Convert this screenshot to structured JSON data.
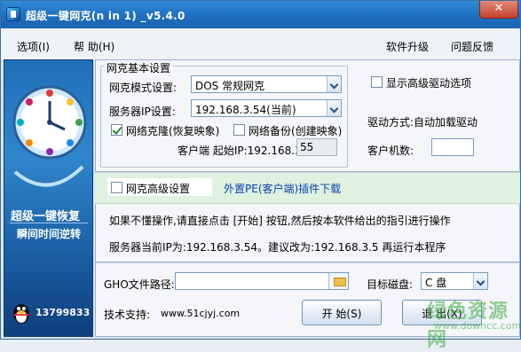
{
  "window": {
    "title": "超级一键网克(n in 1) _v5.4.0",
    "close_label": "✕"
  },
  "menubar": {
    "left": [
      {
        "label": "选项(I)"
      },
      {
        "label": "帮 助(H)"
      }
    ],
    "right": [
      {
        "label": "软件升级"
      },
      {
        "label": "问题反馈"
      }
    ]
  },
  "sidebar": {
    "slogan1": "超级一键恢复",
    "slogan2": "瞬间时间逆转",
    "qq_number": "13799833",
    "clock_icon": "clock-icon",
    "qq_icon": "qq-penguin-icon"
  },
  "basic": {
    "legend": "网克基本设置",
    "mode_label": "网克模式设置:",
    "mode_value": "DOS 常规网克",
    "server_label": "服务器IP设置:",
    "server_value": "192.168.3.54(当前)",
    "clone_restore_label": "网络克隆(恢复映象)",
    "clone_restore_checked": true,
    "backup_label": "网络备份(创建映象)",
    "backup_checked": false,
    "client_ip_label": "客户端 起始IP:192.168.3.",
    "client_ip_value": "55",
    "show_driver_label": "显示高级驱动选项",
    "show_driver_checked": false,
    "driver_mode_text": "驱动方式:自动加载驱动",
    "client_count_label": "客户机数:",
    "client_count_value": ""
  },
  "advanced": {
    "label": "网克高级设置",
    "checked": false,
    "plugin_link": "外置PE(客户端)插件下载"
  },
  "info": {
    "line1": "如果不懂操作,请直接点击 [开始] 按钮,然后按本软件给出的指引进行操作",
    "line2": "服务器当前IP为:192.168.3.54。建议改为:192.168.3.5 再运行本程序"
  },
  "bottom": {
    "gho_label": "GHO文件路径:",
    "gho_value": "",
    "target_label": "目标磁盘:",
    "target_value": "C 盘",
    "support_label": "技术支持:",
    "support_url": "www.51cjyj.com",
    "start_label": "开 始(S)",
    "exit_label": "退 出(X)"
  },
  "watermark": {
    "text": "绿色资源网",
    "url": "www.downcc.com"
  }
}
